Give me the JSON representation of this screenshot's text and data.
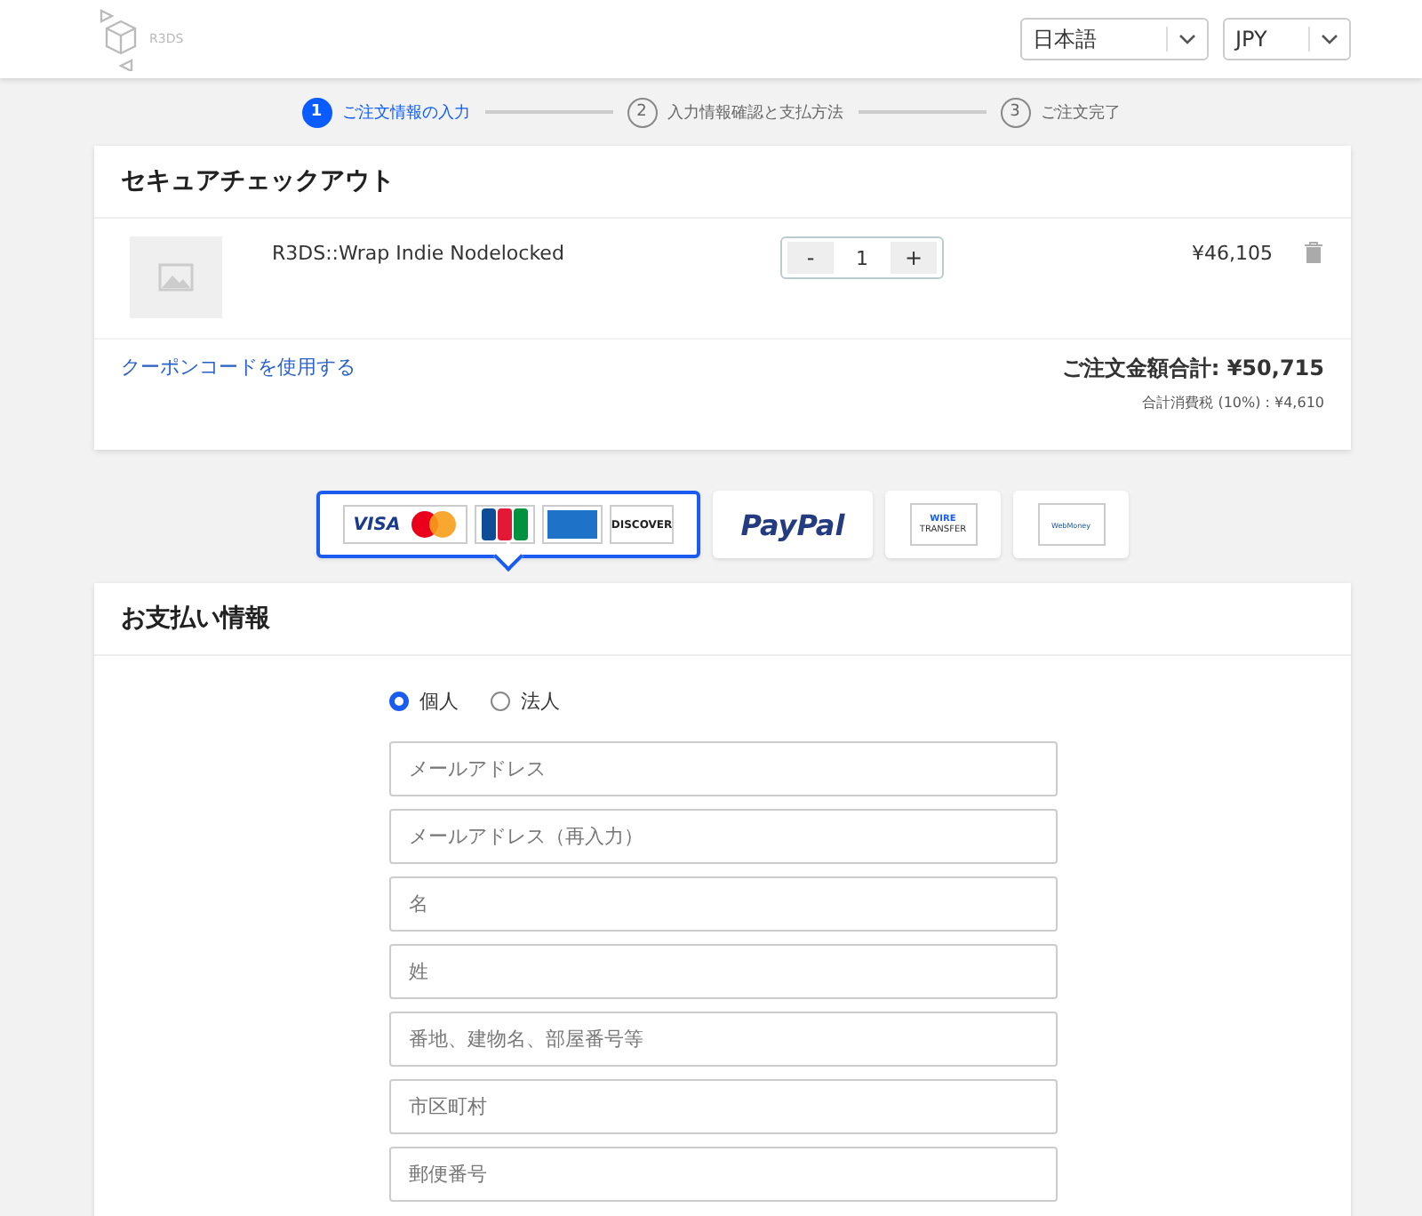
{
  "header": {
    "logo_text": "R3DS",
    "language": "日本語",
    "currency": "JPY"
  },
  "steps": [
    {
      "number": "1",
      "label": "ご注文情報の入力",
      "selected": true
    },
    {
      "number": "2",
      "label": "入力情報確認と支払方法",
      "selected": false
    },
    {
      "number": "3",
      "label": "ご注文完了",
      "selected": false
    }
  ],
  "checkout": {
    "title": "セキュアチェックアウト",
    "item": {
      "name": "R3DS::Wrap Indie Nodelocked",
      "minus": "-",
      "quantity": "1",
      "plus": "+",
      "price": "¥46,105"
    },
    "coupon_link": "クーポンコードを使用する",
    "total": "ご注文金額合計: ¥50,715",
    "tax": "合計消費税 (10%) : ¥4,610"
  },
  "payment_methods": [
    {
      "kind": "cards",
      "selected": true,
      "labels": [
        "VISA",
        "DISCOVER"
      ]
    },
    {
      "kind": "paypal",
      "selected": false,
      "labels": [
        "PayPal"
      ]
    },
    {
      "kind": "wire",
      "selected": false,
      "labels": [
        "WIRE",
        "TRANSFER"
      ]
    },
    {
      "kind": "webmoney",
      "selected": false,
      "labels": [
        "WebMoney"
      ]
    }
  ],
  "payment_info": {
    "title": "お支払い情報",
    "customer_types": [
      {
        "label": "個人",
        "selected": true
      },
      {
        "label": "法人",
        "selected": false
      }
    ],
    "fields": [
      {
        "placeholder": "メールアドレス"
      },
      {
        "placeholder": "メールアドレス（再入力）"
      },
      {
        "placeholder": "名"
      },
      {
        "placeholder": "姓"
      },
      {
        "placeholder": "番地、建物名、部屋番号等"
      },
      {
        "placeholder": "市区町村"
      },
      {
        "placeholder": "郵便番号"
      }
    ]
  }
}
